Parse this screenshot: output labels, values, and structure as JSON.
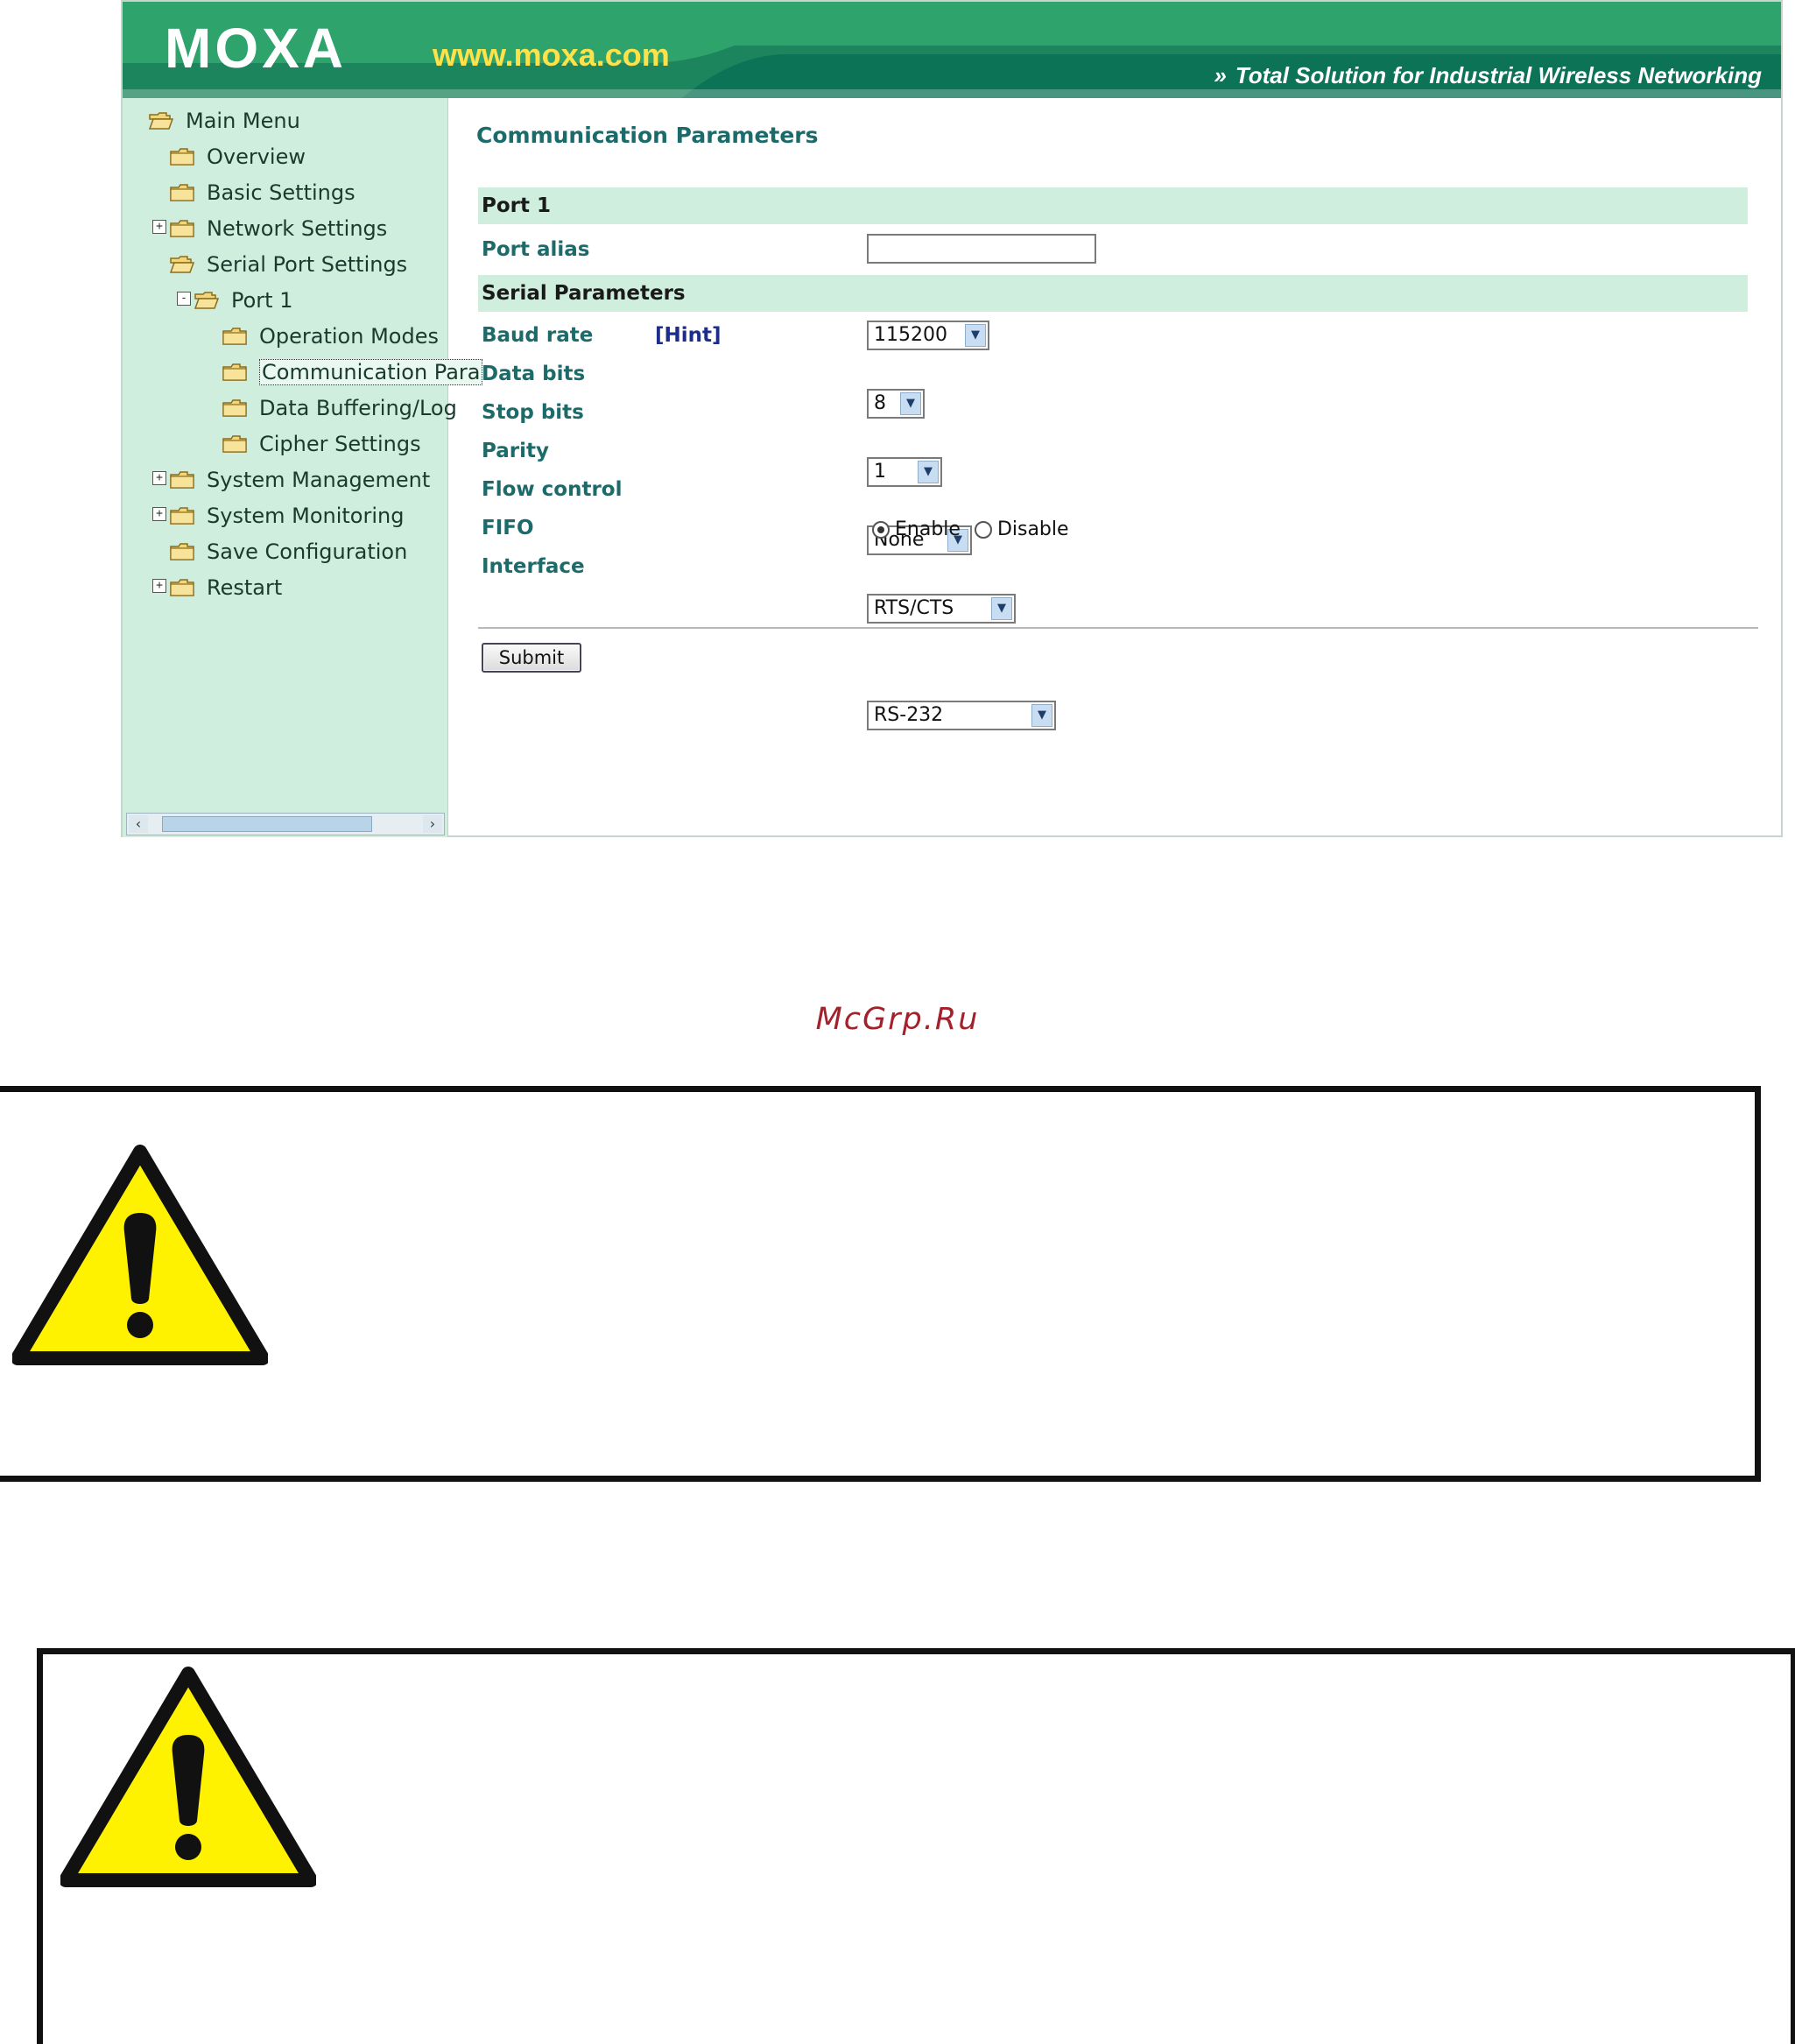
{
  "header": {
    "logo": "MOXA",
    "site": "www.moxa.com",
    "tagline": "Total Solution for Industrial Wireless Networking"
  },
  "sidebar": {
    "items": [
      {
        "label": "Main Menu",
        "icon": "open-folder-icon"
      },
      {
        "label": "Overview",
        "icon": "folder-icon"
      },
      {
        "label": "Basic Settings",
        "icon": "folder-icon"
      },
      {
        "label": "Network Settings",
        "icon": "folder-icon",
        "expander": "+"
      },
      {
        "label": "Serial Port Settings",
        "icon": "open-folder-icon"
      },
      {
        "label": "Port 1",
        "icon": "open-folder-icon",
        "expander": "-"
      },
      {
        "label": "Operation Modes",
        "icon": "folder-icon"
      },
      {
        "label": "Communication Para",
        "icon": "folder-icon",
        "selected": true
      },
      {
        "label": "Data Buffering/Log",
        "icon": "folder-icon"
      },
      {
        "label": "Cipher Settings",
        "icon": "folder-icon"
      },
      {
        "label": "System Management",
        "icon": "folder-icon",
        "expander": "+"
      },
      {
        "label": "System Monitoring",
        "icon": "folder-icon",
        "expander": "+"
      },
      {
        "label": "Save Configuration",
        "icon": "folder-icon"
      },
      {
        "label": "Restart",
        "icon": "folder-icon",
        "expander": "+"
      }
    ]
  },
  "main": {
    "title": "Communication Parameters",
    "port_section": "Port 1",
    "port_alias_label": "Port alias",
    "port_alias_value": "",
    "serial_section": "Serial Parameters",
    "baud_label": "Baud rate",
    "hint_label": "[Hint]",
    "baud_value": "115200",
    "data_bits_label": "Data bits",
    "data_bits_value": "8",
    "stop_bits_label": "Stop bits",
    "stop_bits_value": "1",
    "parity_label": "Parity",
    "parity_value": "None",
    "flow_label": "Flow control",
    "flow_value": "RTS/CTS",
    "fifo_label": "FIFO",
    "fifo_enable": "Enable",
    "fifo_disable": "Disable",
    "fifo_selected": "Enable",
    "interface_label": "Interface",
    "interface_value": "RS-232",
    "submit_label": "Submit"
  },
  "document": {
    "watermark": "McGrp.Ru",
    "warning_icon": "warning-triangle-icon"
  },
  "colors": {
    "banner": "#0a7a5a",
    "sidebar_bg": "#cfeedd",
    "label_teal": "#1c6b6a",
    "warning_yellow": "#fff200"
  }
}
